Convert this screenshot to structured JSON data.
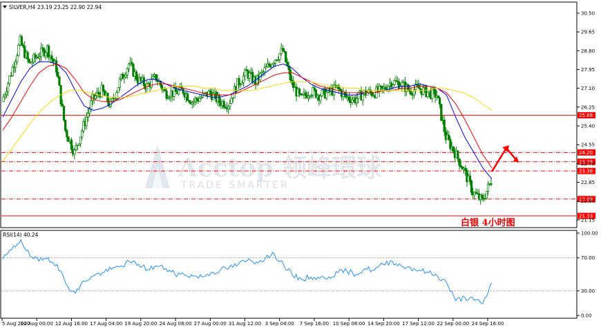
{
  "header": {
    "symbol": "SILVER,H4",
    "ohlc": "23.19 23.25 22.90 22.94"
  },
  "rsi_header": "RSI(14) 40.24",
  "annotation": "白银   4小时图",
  "watermark": {
    "brand": "Acctop 领峰環球",
    "tagline": "TRADE SMARTER"
  },
  "colors": {
    "bull": "#008000",
    "bear": "#008000",
    "ma_fast": "#0000ff",
    "ma_mid": "#ff0000",
    "ma_slow": "#ffd700",
    "level": "#ff0000",
    "rsi": "#1e90ff",
    "arrow": "#ff0000"
  },
  "chart_data": [
    {
      "type": "candlestick",
      "title": "",
      "x_tick_labels": [
        "5 Aug 2020",
        "10 Aug 00:00",
        "12 Aug 16:00",
        "17 Aug 04:00",
        "19 Aug 20:00",
        "24 Aug 08:00",
        "27 Aug 00:00",
        "31 Aug 12:00",
        "3 Sep 04:00",
        "7 Sep 16:00",
        "10 Sep 08:00",
        "14 Sep 20:00",
        "17 Sep 12:00",
        "22 Sep 00:00",
        "24 Sep 16:00"
      ],
      "y_tick_labels": [
        "30.50",
        "29.65",
        "28.80",
        "27.95",
        "27.10",
        "26.25",
        "25.40",
        "24.55",
        "23.70",
        "22.85",
        "22.00",
        "21.15"
      ],
      "ylim": [
        20.8,
        31.0
      ],
      "series": [
        {
          "name": "",
          "role": "ma_fast",
          "values": [
            25.8,
            26.6,
            27.4,
            28.0,
            28.3,
            28.3,
            28.2,
            27.8,
            27.0,
            26.3,
            26.1,
            26.2,
            26.4,
            26.7,
            27.0,
            27.3,
            27.5,
            27.5,
            27.3,
            27.1,
            27.0,
            26.9,
            26.8,
            26.7,
            26.7,
            26.8,
            27.0,
            27.2,
            27.5,
            27.8,
            28.1,
            28.2,
            28.0,
            27.6,
            27.3,
            27.1,
            27.0,
            26.9,
            26.8,
            26.8,
            26.9,
            26.9,
            27.0,
            27.1,
            27.2,
            27.2,
            27.3,
            27.2,
            27.1,
            26.8,
            25.8,
            24.9,
            24.2,
            23.5,
            23.0
          ]
        },
        {
          "name": "",
          "role": "ma_mid",
          "values": [
            25.2,
            25.8,
            26.5,
            27.2,
            27.8,
            28.1,
            28.2,
            28.0,
            27.5,
            26.9,
            26.6,
            26.5,
            26.5,
            26.6,
            26.8,
            27.0,
            27.2,
            27.3,
            27.3,
            27.2,
            27.1,
            27.0,
            26.9,
            26.8,
            26.8,
            26.8,
            26.9,
            27.1,
            27.3,
            27.5,
            27.7,
            27.8,
            27.8,
            27.6,
            27.4,
            27.2,
            27.1,
            27.0,
            26.9,
            26.9,
            26.9,
            26.9,
            27.0,
            27.0,
            27.1,
            27.1,
            27.2,
            27.2,
            27.1,
            26.9,
            26.4,
            25.7,
            24.9,
            24.1,
            23.5
          ]
        },
        {
          "name": "",
          "role": "ma_slow",
          "values": [
            23.8,
            24.4,
            25.0,
            25.6,
            26.1,
            26.5,
            26.8,
            27.0,
            27.0,
            26.9,
            26.8,
            26.7,
            26.7,
            26.7,
            26.8,
            26.9,
            27.0,
            27.1,
            27.2,
            27.2,
            27.2,
            27.1,
            27.1,
            27.0,
            27.0,
            27.0,
            27.0,
            27.1,
            27.2,
            27.3,
            27.4,
            27.4,
            27.4,
            27.3,
            27.2,
            27.2,
            27.1,
            27.1,
            27.0,
            27.0,
            27.0,
            27.0,
            27.0,
            27.0,
            27.0,
            27.1,
            27.1,
            27.0,
            26.9,
            26.7,
            26.4,
            26.1
          ]
        }
      ],
      "close_path": [
        26.5,
        27.8,
        29.2,
        28.2,
        28.6,
        28.9,
        28.0,
        25.2,
        24.2,
        25.4,
        26.6,
        27.0,
        26.3,
        27.4,
        28.2,
        27.5,
        27.2,
        27.6,
        26.9,
        26.9,
        27.0,
        26.5,
        26.7,
        26.9,
        26.5,
        26.4,
        27.3,
        27.8,
        27.4,
        27.9,
        28.4,
        28.8,
        27.3,
        26.6,
        27.0,
        26.8,
        26.9,
        27.1,
        26.7,
        26.6,
        26.9,
        26.9,
        27.0,
        27.4,
        27.3,
        27.0,
        27.1,
        26.9,
        26.8,
        24.9,
        24.2,
        23.4,
        22.4,
        22.0,
        22.9
      ],
      "price_levels": [
        {
          "label": "25.88",
          "value": 25.88,
          "style": "solid"
        },
        {
          "label": "24.20",
          "value": 24.2,
          "style": "dashdot"
        },
        {
          "label": "23.78",
          "value": 23.78,
          "style": "dashdot"
        },
        {
          "label": "23.36",
          "value": 23.36,
          "style": "dashdot"
        },
        {
          "label": "22.09",
          "value": 22.09,
          "style": "dashdot"
        },
        {
          "label": "21.33",
          "value": 21.33,
          "style": "solid"
        }
      ]
    },
    {
      "type": "line",
      "title": "RSI(14) 40.24",
      "y_tick_labels": [
        "100.00",
        "70.00",
        "30.00",
        "0.00"
      ],
      "ylim": [
        0,
        100
      ],
      "reference_lines": [
        70,
        30
      ],
      "series": [
        {
          "name": "",
          "values": [
            68,
            80,
            92,
            72,
            66,
            70,
            62,
            38,
            27,
            42,
            48,
            52,
            56,
            60,
            65,
            62,
            56,
            60,
            57,
            50,
            50,
            48,
            47,
            52,
            55,
            58,
            62,
            67,
            65,
            70,
            74,
            62,
            48,
            44,
            47,
            45,
            47,
            52,
            54,
            50,
            57,
            55,
            62,
            66,
            60,
            58,
            55,
            52,
            48,
            40,
            18,
            22,
            19,
            14,
            40
          ]
        }
      ]
    }
  ]
}
